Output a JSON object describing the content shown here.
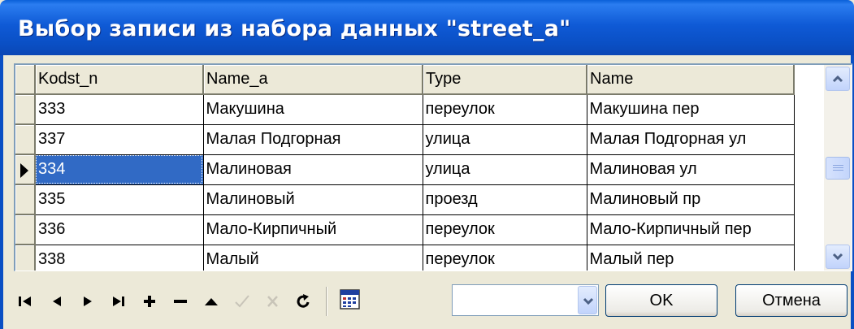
{
  "window": {
    "title": "Выбор записи из набора данных \"street_a\""
  },
  "grid": {
    "columns": [
      "Kodst_n",
      "Name_a",
      "Type",
      "Name"
    ],
    "rows": [
      [
        "333",
        "Макушина",
        "переулок",
        "Макушина пер"
      ],
      [
        "337",
        "Малая Подгорная",
        "улица",
        "Малая Подгорная ул"
      ],
      [
        "334",
        "Малиновая",
        "улица",
        "Малиновая ул"
      ],
      [
        "335",
        "Малиновый",
        "проезд",
        "Малиновый пр"
      ],
      [
        "336",
        "Мало-Кирпичный",
        "переулок",
        "Мало-Кирпичный пер"
      ],
      [
        "338",
        "Малый",
        "переулок",
        "Малый пер"
      ]
    ],
    "current_row_index": 2
  },
  "navigator": {
    "buttons": [
      "first-icon",
      "prior-icon",
      "next-icon",
      "last-icon",
      "insert-icon",
      "delete-icon",
      "edit-icon",
      "post-icon",
      "cancel-icon",
      "refresh-icon"
    ],
    "disabled": [
      "post-icon",
      "cancel-icon"
    ]
  },
  "filter_combo": {
    "value": ""
  },
  "buttons": {
    "ok": "OK",
    "cancel": "Отмена"
  },
  "colors": {
    "title_bar": "#0a4fc4",
    "selection": "#316ac5",
    "face": "#ece9d8"
  }
}
